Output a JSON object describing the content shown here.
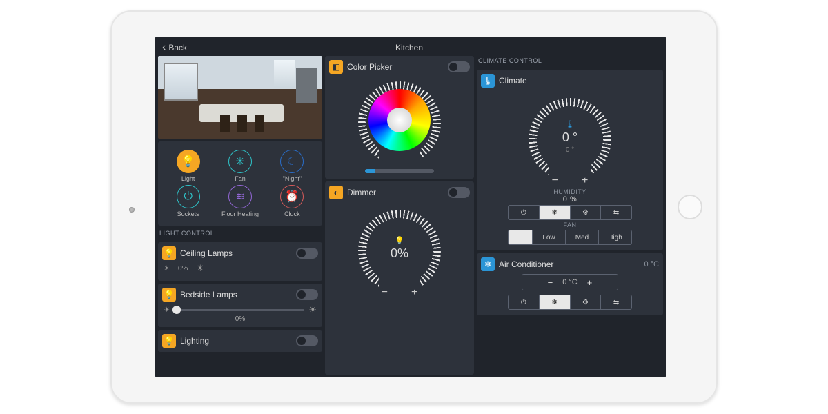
{
  "header": {
    "back": "Back",
    "title": "Kitchen"
  },
  "quick": {
    "items": [
      {
        "label": "Light",
        "active": true,
        "glyph": "💡"
      },
      {
        "label": "Fan",
        "glyph": "✳"
      },
      {
        "label": "\"Night\"",
        "glyph": "☾"
      },
      {
        "label": "Sockets",
        "glyph": "⏻"
      },
      {
        "label": "Floor Heating",
        "glyph": "≋"
      },
      {
        "label": "Clock",
        "glyph": "⏰"
      }
    ]
  },
  "light_control": {
    "header": "LIGHT CONTROL",
    "ceiling": {
      "label": "Ceiling Lamps",
      "percent": "0%"
    },
    "bedside": {
      "label": "Bedside Lamps",
      "percent": "0%"
    },
    "lighting": {
      "label": "Lighting"
    }
  },
  "color_picker": {
    "label": "Color Picker"
  },
  "dimmer": {
    "label": "Dimmer",
    "value": "0%"
  },
  "climate": {
    "header": "CLIMATE CONTROL",
    "label": "Climate",
    "current": "0 °",
    "set": "0 °",
    "humidity_label": "HUMIDITY",
    "humidity_value": "0 %",
    "mode_icons": [
      "⏻",
      "❄",
      "⚙",
      "⇆"
    ],
    "fan_label": "FAN",
    "fan_opts": [
      "Low",
      "Med",
      "High"
    ]
  },
  "ac": {
    "label": "Air Conditioner",
    "reading": "0 °C",
    "set": "0 °C",
    "mode_icons": [
      "⏻",
      "❄",
      "⚙",
      "⇆"
    ]
  }
}
